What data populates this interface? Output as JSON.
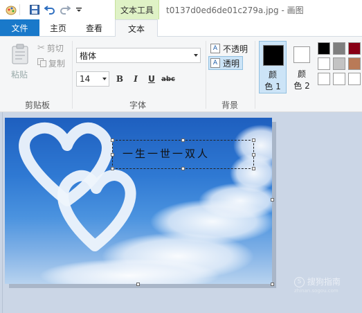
{
  "window": {
    "title": "t0137d0ed6de01c279a.jpg - 画图",
    "context_tab": "文本工具"
  },
  "tabs": {
    "file": "文件",
    "home": "主页",
    "view": "查看",
    "text": "文本"
  },
  "clipboard": {
    "paste": "粘贴",
    "cut": "剪切",
    "copy": "复制",
    "group": "剪贴板"
  },
  "font": {
    "family": "楷体",
    "size": "14",
    "bold": "B",
    "italic": "I",
    "underline": "U",
    "strike": "abc",
    "group": "字体"
  },
  "background": {
    "opaque": "不透明",
    "transparent": "透明",
    "group": "背景"
  },
  "colors": {
    "color1_line1": "颜",
    "color1_line2": "色 1",
    "color2_line1": "颜",
    "color2_line2": "色 2",
    "color1_value": "#000000",
    "color2_value": "#ffffff",
    "palette": [
      "#000000",
      "#7f7f7f",
      "#880015",
      "#ffffff",
      "#c3c3c3",
      "#b97a57",
      "#ffffff",
      "#ffffff",
      "#ffffff"
    ]
  },
  "canvas": {
    "text": "一生一世一双人"
  },
  "watermark": {
    "line1": "搜狗指南",
    "line2": "zhinan.sogou.com"
  }
}
